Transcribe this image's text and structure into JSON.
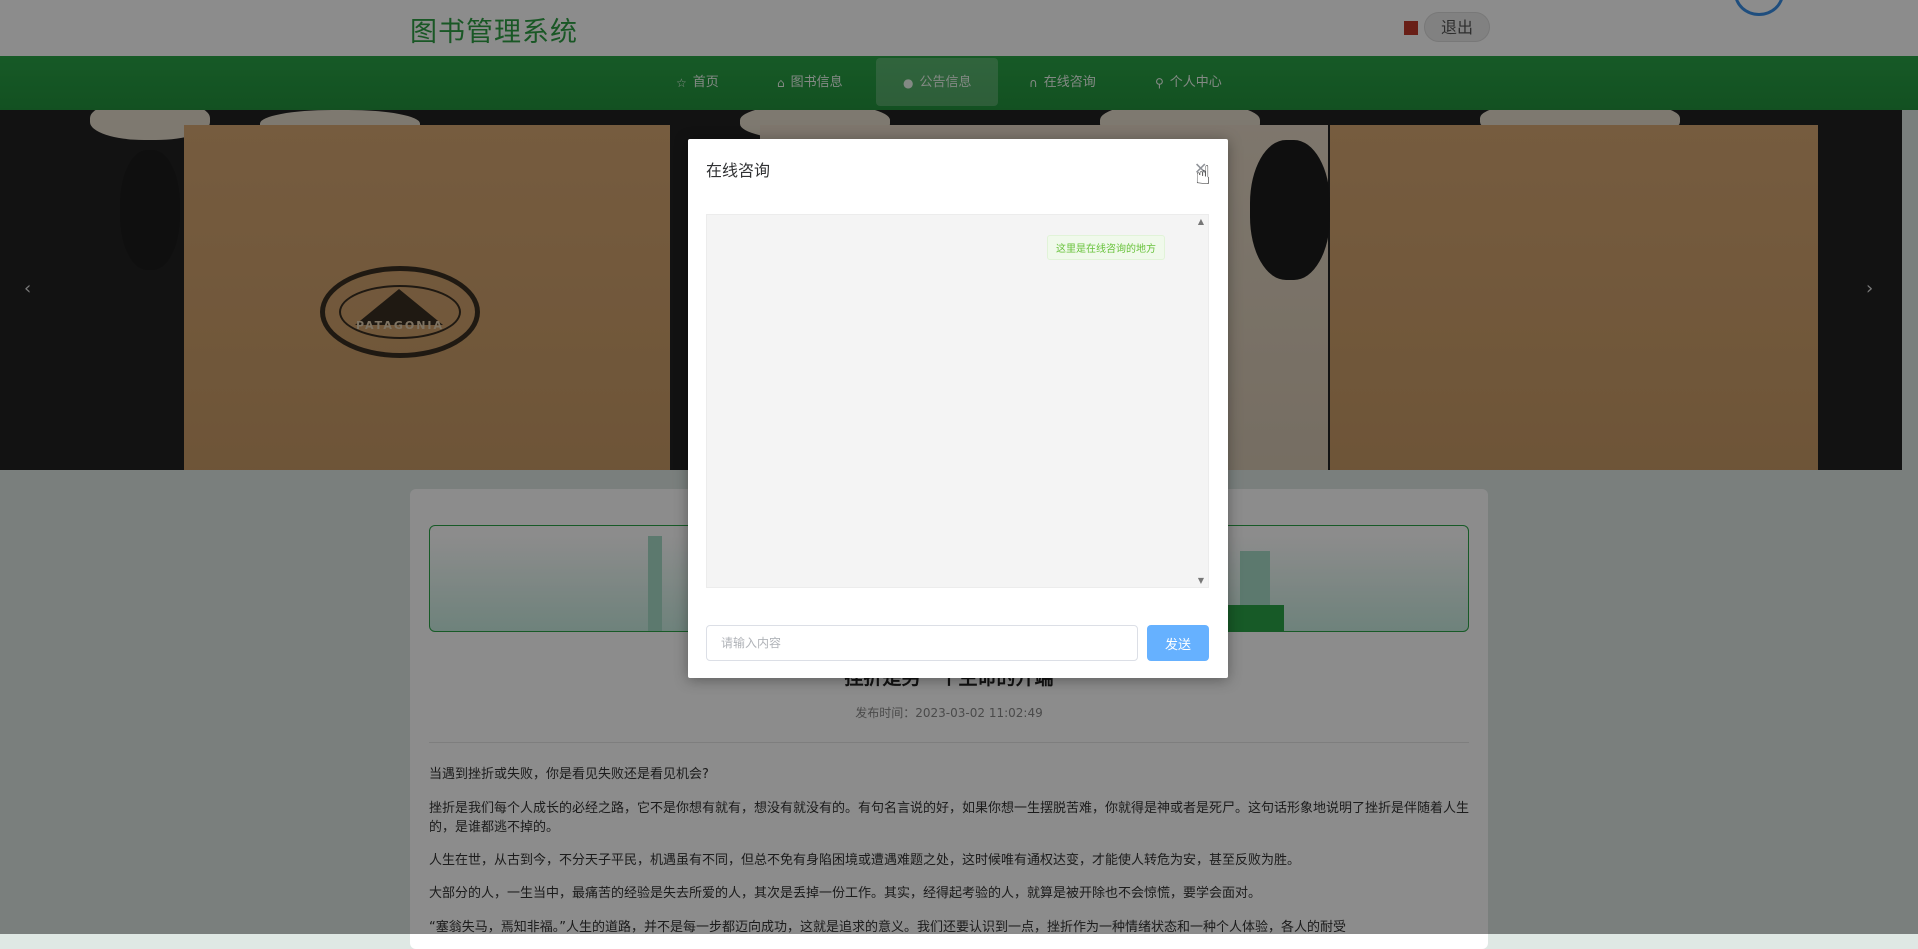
{
  "header": {
    "site_title": "图书管理系统",
    "logout_label": "退出"
  },
  "nav": {
    "items": [
      {
        "label": "首页",
        "icon": "star-icon"
      },
      {
        "label": "图书信息",
        "icon": "bag-icon"
      },
      {
        "label": "公告信息",
        "icon": "info-icon"
      },
      {
        "label": "在线咨询",
        "icon": "headset-icon"
      },
      {
        "label": "个人中心",
        "icon": "user-icon"
      }
    ],
    "active": "公告信息"
  },
  "banner": {
    "emblem_text": "PATAGONIA",
    "prev_icon": "chevron-left-icon",
    "next_icon": "chevron-right-icon"
  },
  "article": {
    "title": "挫折是另一个生命的开端",
    "publish_label": "发布时间：2023-03-02 11:02:49",
    "paragraphs": [
      "当遇到挫折或失败，你是看见失败还是看见机会?",
      "挫折是我们每个人成长的必经之路，它不是你想有就有，想没有就没有的。有句名言说的好，如果你想一生摆脱苦难，你就得是神或者是死尸。这句话形象地说明了挫折是伴随着人生的，是谁都逃不掉的。",
      "人生在世，从古到今，不分天子平民，机遇虽有不同，但总不免有身陷困境或遭遇难题之处，这时候唯有通权达变，才能使人转危为安，甚至反败为胜。",
      "大部分的人，一生当中，最痛苦的经验是失去所爱的人，其次是丢掉一份工作。其实，经得起考验的人，就算是被开除也不会惊慌，要学会面对。",
      "“塞翁失马，焉知非福。”人生的道路，并不是每一步都迈向成功，这就是追求的意义。我们还要认识到一点，挫折作为一种情绪状态和一种个人体验，各人的耐受"
    ]
  },
  "dialog": {
    "title": "在线咨询",
    "close_icon": "close-icon",
    "welcome_message": "这里是在线咨询的地方",
    "input_placeholder": "请输入内容",
    "send_label": "发送"
  },
  "colors": {
    "brand_green": "#2aa447",
    "send_blue": "#66b1ff",
    "bubble_green": "#67c23a"
  }
}
